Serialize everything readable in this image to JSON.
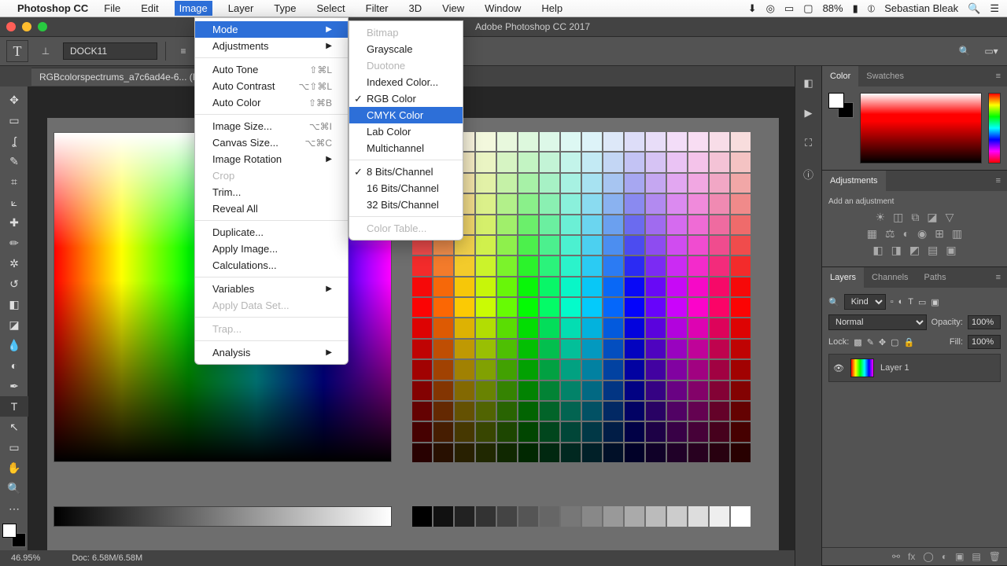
{
  "menubar": {
    "app": "Photoshop CC",
    "items": [
      "File",
      "Edit",
      "Image",
      "Layer",
      "Type",
      "Select",
      "Filter",
      "3D",
      "View",
      "Window",
      "Help"
    ],
    "active": "Image",
    "battery": "88%",
    "user": "Sebastian Bleak"
  },
  "window": {
    "title": "Adobe Photoshop CC 2017"
  },
  "options": {
    "font": "DOCK11"
  },
  "doc_tab": {
    "name": "RGBcolorspectrums_a7c6ad4e-6... (RGB/8) *"
  },
  "image_menu": [
    {
      "label": "Mode",
      "arrow": true,
      "hl": true
    },
    {
      "label": "Adjustments",
      "arrow": true,
      "sep_after": true
    },
    {
      "label": "Auto Tone",
      "sc": "⇧⌘L"
    },
    {
      "label": "Auto Contrast",
      "sc": "⌥⇧⌘L"
    },
    {
      "label": "Auto Color",
      "sc": "⇧⌘B",
      "sep_after": true
    },
    {
      "label": "Image Size...",
      "sc": "⌥⌘I"
    },
    {
      "label": "Canvas Size...",
      "sc": "⌥⌘C"
    },
    {
      "label": "Image Rotation",
      "arrow": true
    },
    {
      "label": "Crop",
      "disabled": true
    },
    {
      "label": "Trim..."
    },
    {
      "label": "Reveal All",
      "sep_after": true
    },
    {
      "label": "Duplicate..."
    },
    {
      "label": "Apply Image..."
    },
    {
      "label": "Calculations...",
      "sep_after": true
    },
    {
      "label": "Variables",
      "arrow": true
    },
    {
      "label": "Apply Data Set...",
      "disabled": true,
      "sep_after": true
    },
    {
      "label": "Trap...",
      "disabled": true,
      "sep_after": true
    },
    {
      "label": "Analysis",
      "arrow": true
    }
  ],
  "mode_menu": [
    {
      "label": "Bitmap",
      "disabled": true
    },
    {
      "label": "Grayscale"
    },
    {
      "label": "Duotone",
      "disabled": true
    },
    {
      "label": "Indexed Color..."
    },
    {
      "label": "RGB Color",
      "check": true
    },
    {
      "label": "CMYK Color",
      "hl": true
    },
    {
      "label": "Lab Color"
    },
    {
      "label": "Multichannel",
      "sep_after": true
    },
    {
      "label": "8 Bits/Channel",
      "check": true
    },
    {
      "label": "16 Bits/Channel"
    },
    {
      "label": "32 Bits/Channel",
      "sep_after": true
    },
    {
      "label": "Color Table...",
      "disabled": true
    }
  ],
  "panels": {
    "color": {
      "tabs": [
        "Color",
        "Swatches"
      ]
    },
    "adjustments": {
      "title": "Adjustments",
      "hint": "Add an adjustment"
    },
    "layers": {
      "tabs": [
        "Layers",
        "Channels",
        "Paths"
      ],
      "kind": "Kind",
      "blend": "Normal",
      "opacity_label": "Opacity:",
      "opacity": "100%",
      "lock_label": "Lock:",
      "fill_label": "Fill:",
      "fill": "100%",
      "layer_name": "Layer 1"
    }
  },
  "status": {
    "zoom": "46.95%",
    "doc": "Doc: 6.58M/6.58M"
  }
}
